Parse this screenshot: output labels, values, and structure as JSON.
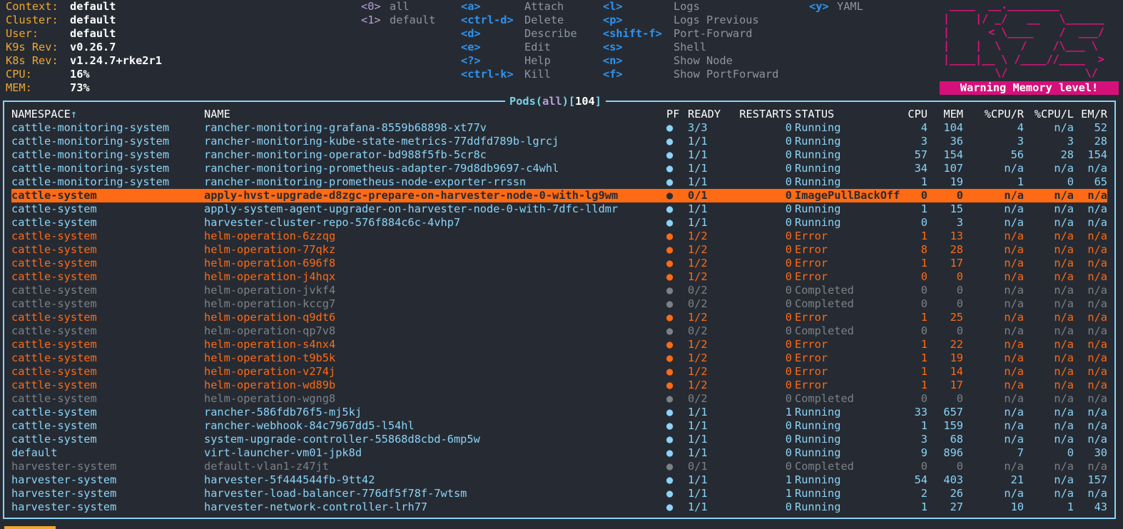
{
  "context": {
    "labels": [
      "Context:",
      "Cluster:",
      "User:",
      "K9s Rev:",
      "K8s Rev:",
      "CPU:",
      "MEM:"
    ],
    "values": [
      "default",
      "default",
      "default",
      "v0.26.7",
      "v1.24.7+rke2r1",
      "16%",
      "73%"
    ]
  },
  "namespaces_shortcuts": [
    {
      "key": "<0>",
      "label": "all"
    },
    {
      "key": "<1>",
      "label": "default"
    }
  ],
  "shortcuts_col1": [
    {
      "key": "<a>",
      "label": "Attach"
    },
    {
      "key": "<ctrl-d>",
      "label": "Delete"
    },
    {
      "key": "<d>",
      "label": "Describe"
    },
    {
      "key": "<e>",
      "label": "Edit"
    },
    {
      "key": "<?>",
      "label": "Help"
    },
    {
      "key": "<ctrl-k>",
      "label": "Kill"
    }
  ],
  "shortcuts_col2": [
    {
      "key": "<l>",
      "label": "Logs"
    },
    {
      "key": "<p>",
      "label": "Logs Previous"
    },
    {
      "key": "<shift-f>",
      "label": "Port-Forward"
    },
    {
      "key": "<s>",
      "label": "Shell"
    },
    {
      "key": "<n>",
      "label": "Show Node"
    },
    {
      "key": "<f>",
      "label": "Show PortForward"
    }
  ],
  "shortcuts_col3": [
    {
      "key": "<y>",
      "label": "YAML"
    }
  ],
  "logo_lines": [
    " ____  __.________       ",
    "|    |/ _/   __   \\______",
    "|      < \\____    /  ___/",
    "|    |  \\   /    /\\___ \\ ",
    "|____|__ \\ /____//____  >",
    "        \\/            \\/ "
  ],
  "warning": "Warning Memory level!",
  "title": {
    "resource": "Pods",
    "ns": "all",
    "count": "104"
  },
  "columns": [
    "NAMESPACE",
    "NAME",
    "PF",
    "READY",
    "RESTARTS",
    "STATUS",
    "CPU",
    "MEM",
    "%CPU/R",
    "%CPU/L",
    "EM/R"
  ],
  "sort_indicator": "↑",
  "pf_glyph": "●",
  "rows": [
    {
      "ns": "cattle-monitoring-system",
      "name": "rancher-monitoring-grafana-8559b68898-xt77v",
      "ready": "3/3",
      "restarts": "0",
      "status": "Running",
      "cpu": "4",
      "mem": "104",
      "cpur": "4",
      "cpul": "n/a",
      "emr": "52",
      "state": "running"
    },
    {
      "ns": "cattle-monitoring-system",
      "name": "rancher-monitoring-kube-state-metrics-77ddfd789b-lgrcj",
      "ready": "1/1",
      "restarts": "0",
      "status": "Running",
      "cpu": "3",
      "mem": "36",
      "cpur": "3",
      "cpul": "3",
      "emr": "28",
      "state": "running"
    },
    {
      "ns": "cattle-monitoring-system",
      "name": "rancher-monitoring-operator-bd988f5fb-5cr8c",
      "ready": "1/1",
      "restarts": "0",
      "status": "Running",
      "cpu": "57",
      "mem": "154",
      "cpur": "56",
      "cpul": "28",
      "emr": "154",
      "state": "running"
    },
    {
      "ns": "cattle-monitoring-system",
      "name": "rancher-monitoring-prometheus-adapter-79d8db9697-c4whl",
      "ready": "1/1",
      "restarts": "0",
      "status": "Running",
      "cpu": "34",
      "mem": "107",
      "cpur": "n/a",
      "cpul": "n/a",
      "emr": "n/a",
      "state": "running"
    },
    {
      "ns": "cattle-monitoring-system",
      "name": "rancher-monitoring-prometheus-node-exporter-rrssn",
      "ready": "1/1",
      "restarts": "0",
      "status": "Running",
      "cpu": "1",
      "mem": "19",
      "cpur": "1",
      "cpul": "0",
      "emr": "65",
      "state": "running"
    },
    {
      "ns": "cattle-system",
      "name": "apply-hvst-upgrade-d8zgc-prepare-on-harvester-node-0-with-lg9wm",
      "ready": "0/1",
      "restarts": "0",
      "status": "ImagePullBackOff",
      "cpu": "0",
      "mem": "0",
      "cpur": "n/a",
      "cpul": "n/a",
      "emr": "n/a",
      "state": "selected"
    },
    {
      "ns": "cattle-system",
      "name": "apply-system-agent-upgrader-on-harvester-node-0-with-7dfc-lldmr",
      "ready": "1/1",
      "restarts": "0",
      "status": "Running",
      "cpu": "1",
      "mem": "15",
      "cpur": "n/a",
      "cpul": "n/a",
      "emr": "n/a",
      "state": "running"
    },
    {
      "ns": "cattle-system",
      "name": "harvester-cluster-repo-576f884c6c-4vhp7",
      "ready": "1/1",
      "restarts": "0",
      "status": "Running",
      "cpu": "0",
      "mem": "3",
      "cpur": "n/a",
      "cpul": "n/a",
      "emr": "n/a",
      "state": "running"
    },
    {
      "ns": "cattle-system",
      "name": "helm-operation-6zzqg",
      "ready": "1/2",
      "restarts": "0",
      "status": "Error",
      "cpu": "1",
      "mem": "13",
      "cpur": "n/a",
      "cpul": "n/a",
      "emr": "n/a",
      "state": "error"
    },
    {
      "ns": "cattle-system",
      "name": "helm-operation-77qkz",
      "ready": "1/2",
      "restarts": "0",
      "status": "Error",
      "cpu": "8",
      "mem": "28",
      "cpur": "n/a",
      "cpul": "n/a",
      "emr": "n/a",
      "state": "error"
    },
    {
      "ns": "cattle-system",
      "name": "helm-operation-696f8",
      "ready": "1/2",
      "restarts": "0",
      "status": "Error",
      "cpu": "1",
      "mem": "17",
      "cpur": "n/a",
      "cpul": "n/a",
      "emr": "n/a",
      "state": "error"
    },
    {
      "ns": "cattle-system",
      "name": "helm-operation-j4hqx",
      "ready": "1/2",
      "restarts": "0",
      "status": "Error",
      "cpu": "0",
      "mem": "0",
      "cpur": "n/a",
      "cpul": "n/a",
      "emr": "n/a",
      "state": "error"
    },
    {
      "ns": "cattle-system",
      "name": "helm-operation-jvkf4",
      "ready": "0/2",
      "restarts": "0",
      "status": "Completed",
      "cpu": "0",
      "mem": "0",
      "cpur": "n/a",
      "cpul": "n/a",
      "emr": "n/a",
      "state": "completed"
    },
    {
      "ns": "cattle-system",
      "name": "helm-operation-kccg7",
      "ready": "0/2",
      "restarts": "0",
      "status": "Completed",
      "cpu": "0",
      "mem": "0",
      "cpur": "n/a",
      "cpul": "n/a",
      "emr": "n/a",
      "state": "completed"
    },
    {
      "ns": "cattle-system",
      "name": "helm-operation-q9dt6",
      "ready": "1/2",
      "restarts": "0",
      "status": "Error",
      "cpu": "1",
      "mem": "25",
      "cpur": "n/a",
      "cpul": "n/a",
      "emr": "n/a",
      "state": "error"
    },
    {
      "ns": "cattle-system",
      "name": "helm-operation-qp7v8",
      "ready": "0/2",
      "restarts": "0",
      "status": "Completed",
      "cpu": "0",
      "mem": "0",
      "cpur": "n/a",
      "cpul": "n/a",
      "emr": "n/a",
      "state": "completed"
    },
    {
      "ns": "cattle-system",
      "name": "helm-operation-s4nx4",
      "ready": "1/2",
      "restarts": "0",
      "status": "Error",
      "cpu": "1",
      "mem": "22",
      "cpur": "n/a",
      "cpul": "n/a",
      "emr": "n/a",
      "state": "error"
    },
    {
      "ns": "cattle-system",
      "name": "helm-operation-t9b5k",
      "ready": "1/2",
      "restarts": "0",
      "status": "Error",
      "cpu": "1",
      "mem": "19",
      "cpur": "n/a",
      "cpul": "n/a",
      "emr": "n/a",
      "state": "error"
    },
    {
      "ns": "cattle-system",
      "name": "helm-operation-v274j",
      "ready": "1/2",
      "restarts": "0",
      "status": "Error",
      "cpu": "1",
      "mem": "14",
      "cpur": "n/a",
      "cpul": "n/a",
      "emr": "n/a",
      "state": "error"
    },
    {
      "ns": "cattle-system",
      "name": "helm-operation-wd89b",
      "ready": "1/2",
      "restarts": "0",
      "status": "Error",
      "cpu": "1",
      "mem": "17",
      "cpur": "n/a",
      "cpul": "n/a",
      "emr": "n/a",
      "state": "error"
    },
    {
      "ns": "cattle-system",
      "name": "helm-operation-wgng8",
      "ready": "0/2",
      "restarts": "0",
      "status": "Completed",
      "cpu": "0",
      "mem": "0",
      "cpur": "n/a",
      "cpul": "n/a",
      "emr": "n/a",
      "state": "completed"
    },
    {
      "ns": "cattle-system",
      "name": "rancher-586fdb76f5-mj5kj",
      "ready": "1/1",
      "restarts": "1",
      "status": "Running",
      "cpu": "33",
      "mem": "657",
      "cpur": "n/a",
      "cpul": "n/a",
      "emr": "n/a",
      "state": "running"
    },
    {
      "ns": "cattle-system",
      "name": "rancher-webhook-84c7967dd5-l54hl",
      "ready": "1/1",
      "restarts": "0",
      "status": "Running",
      "cpu": "1",
      "mem": "159",
      "cpur": "n/a",
      "cpul": "n/a",
      "emr": "n/a",
      "state": "running"
    },
    {
      "ns": "cattle-system",
      "name": "system-upgrade-controller-55868d8cbd-6mp5w",
      "ready": "1/1",
      "restarts": "0",
      "status": "Running",
      "cpu": "3",
      "mem": "68",
      "cpur": "n/a",
      "cpul": "n/a",
      "emr": "n/a",
      "state": "running"
    },
    {
      "ns": "default",
      "name": "virt-launcher-vm01-jpk8d",
      "ready": "1/1",
      "restarts": "0",
      "status": "Running",
      "cpu": "9",
      "mem": "896",
      "cpur": "7",
      "cpul": "0",
      "emr": "30",
      "state": "running"
    },
    {
      "ns": "harvester-system",
      "name": "default-vlan1-z47jt",
      "ready": "0/1",
      "restarts": "0",
      "status": "Completed",
      "cpu": "0",
      "mem": "0",
      "cpur": "n/a",
      "cpul": "n/a",
      "emr": "n/a",
      "state": "completed"
    },
    {
      "ns": "harvester-system",
      "name": "harvester-5f444544fb-9tt42",
      "ready": "1/1",
      "restarts": "1",
      "status": "Running",
      "cpu": "54",
      "mem": "403",
      "cpur": "21",
      "cpul": "n/a",
      "emr": "157",
      "state": "running"
    },
    {
      "ns": "harvester-system",
      "name": "harvester-load-balancer-776df5f78f-7wtsm",
      "ready": "1/1",
      "restarts": "1",
      "status": "Running",
      "cpu": "2",
      "mem": "26",
      "cpur": "n/a",
      "cpul": "n/a",
      "emr": "n/a",
      "state": "running"
    },
    {
      "ns": "harvester-system",
      "name": "harvester-network-controller-lrh77",
      "ready": "1/1",
      "restarts": "0",
      "status": "Running",
      "cpu": "1",
      "mem": "27",
      "cpur": "10",
      "cpul": "1",
      "emr": "43",
      "state": "running"
    }
  ]
}
